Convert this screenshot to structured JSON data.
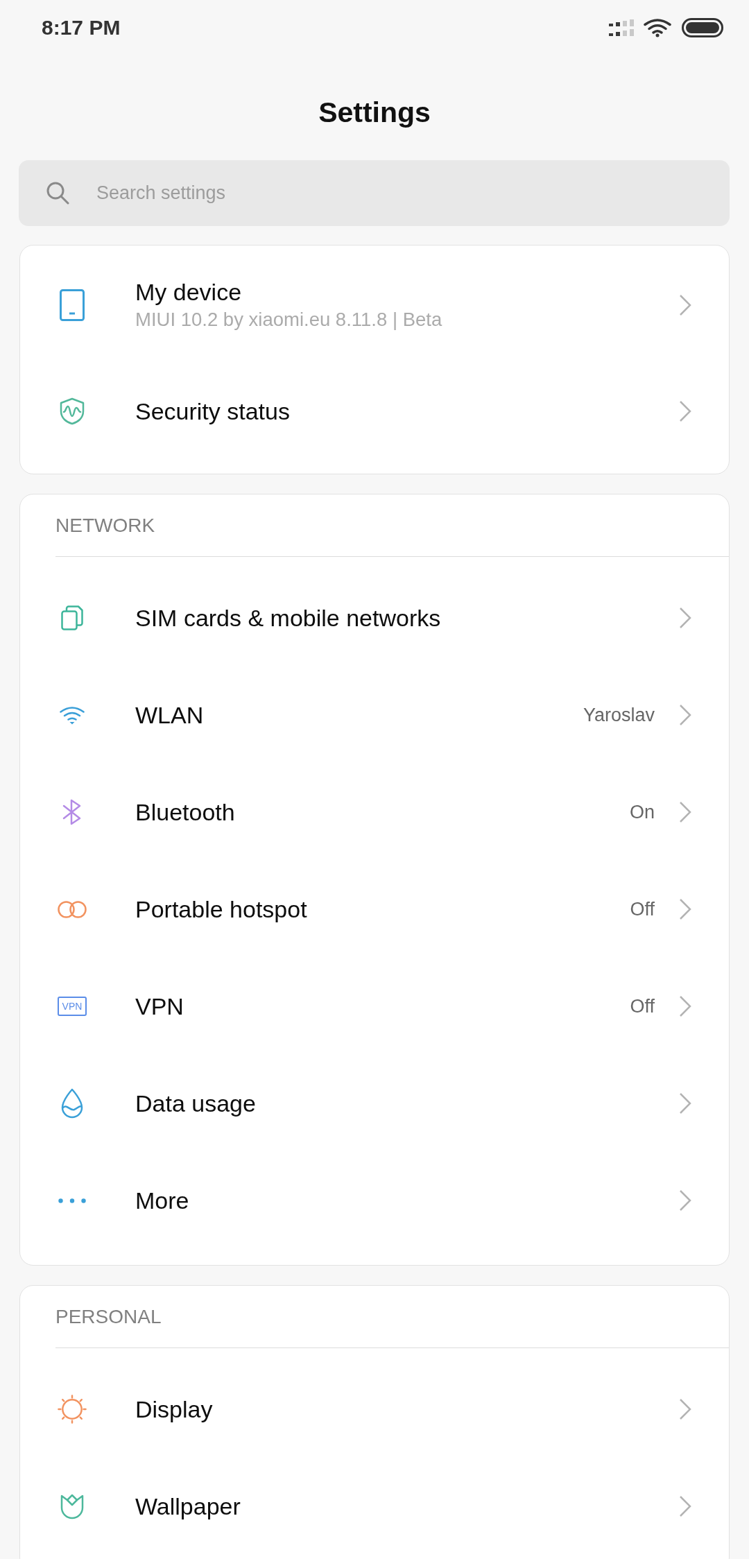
{
  "status_bar": {
    "time": "8:17 PM"
  },
  "header": {
    "title": "Settings"
  },
  "search": {
    "placeholder": "Search settings"
  },
  "sections": [
    {
      "items": [
        {
          "label": "My device",
          "subtitle": "MIUI 10.2 by xiaomi.eu 8.11.8 | Beta"
        },
        {
          "label": "Security status"
        }
      ]
    },
    {
      "heading": "NETWORK",
      "items": [
        {
          "label": "SIM cards & mobile networks"
        },
        {
          "label": "WLAN",
          "value": "Yaroslav"
        },
        {
          "label": "Bluetooth",
          "value": "On"
        },
        {
          "label": "Portable hotspot",
          "value": "Off"
        },
        {
          "label": "VPN",
          "value": "Off",
          "icon_text": "VPN"
        },
        {
          "label": "Data usage"
        },
        {
          "label": "More"
        }
      ]
    },
    {
      "heading": "PERSONAL",
      "items": [
        {
          "label": "Display"
        },
        {
          "label": "Wallpaper"
        }
      ]
    }
  ]
}
